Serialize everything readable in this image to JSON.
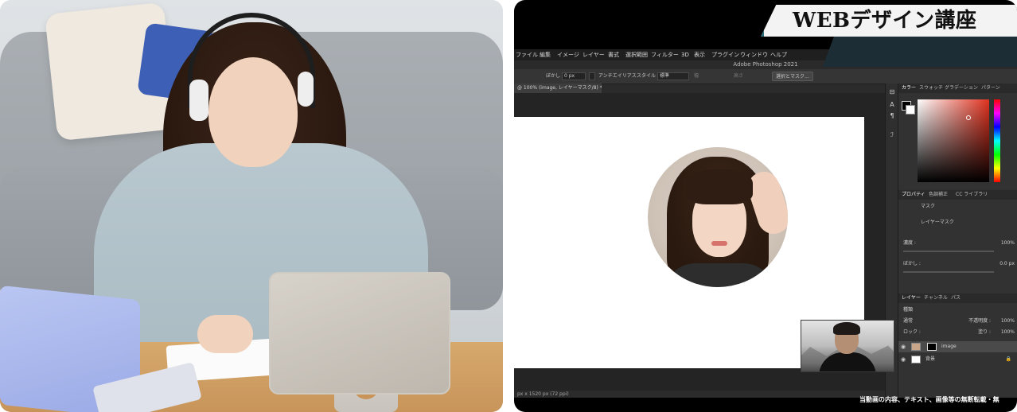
{
  "banner": {
    "title": "WEBデザイン講座"
  },
  "photoshop": {
    "app_title": "Adobe Photoshop 2021",
    "menu": [
      "ファイル",
      "編集",
      "イメージ",
      "レイヤー",
      "書式",
      "選択範囲",
      "フィルター",
      "3D",
      "表示",
      "プラグイン",
      "ウィンドウ",
      "ヘルプ"
    ],
    "options": {
      "feather_label": "ぼかし :",
      "feather_value": "0 px",
      "antialias_label": "アンチエイリアス",
      "style_label": "スタイル :",
      "style_value": "標準",
      "width_label": "幅",
      "height_label": "高さ",
      "select_mask_button": "選択とマスク..."
    },
    "document_tab": "@ 100% (image, レイヤーマスク/8) *",
    "status": "px x 1520 px (72 ppi)",
    "panels": {
      "color_tabs": [
        "カラー",
        "スウォッチ",
        "グラデーション",
        "パターン"
      ],
      "properties_tabs": [
        "プロパティ",
        "色調補正",
        "CC ライブラリ"
      ],
      "mask_label": "マスク",
      "layer_mask_label": "レイヤーマスク",
      "density_label": "濃度 :",
      "density_value": "100%",
      "feather_label": "ぼかし :",
      "feather_value": "0.0 px",
      "layers_tabs": [
        "レイヤー",
        "チャンネル",
        "パス"
      ],
      "kind_label": "種類",
      "blend_mode": "通常",
      "opacity_label": "不透明度 :",
      "opacity_value": "100%",
      "lock_label": "ロック :",
      "fill_label": "塗り :",
      "fill_value": "100%",
      "layers": [
        {
          "name": "image",
          "selected": true
        },
        {
          "name": "背景",
          "selected": false
        }
      ]
    }
  },
  "caption": "当動画の内容、テキスト、画像等の無断転載・無"
}
